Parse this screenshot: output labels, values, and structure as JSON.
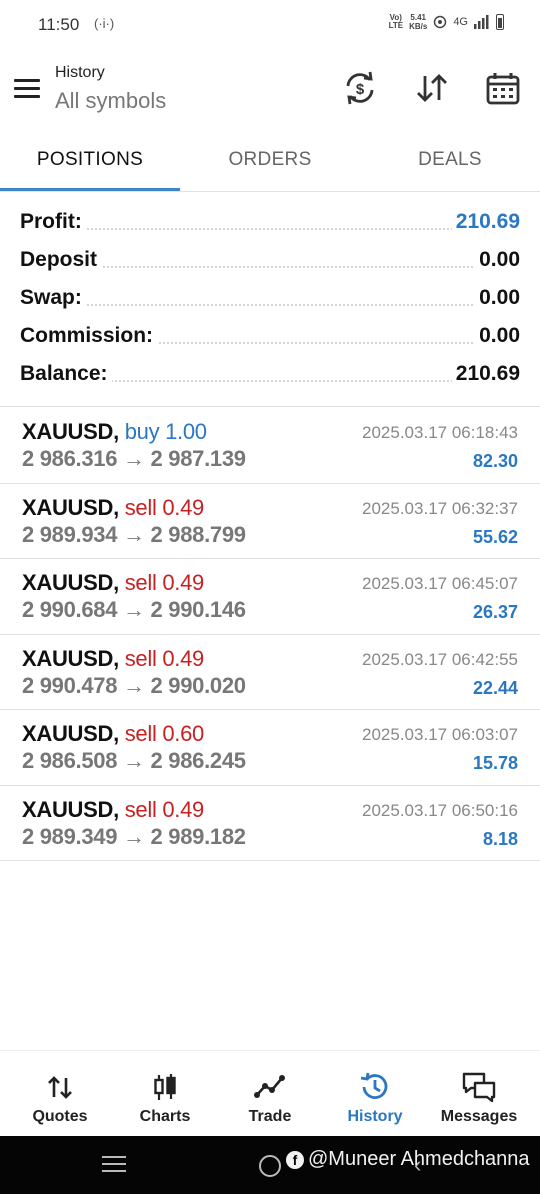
{
  "status_bar": {
    "time": "11:50",
    "hotspot": "(·i·)",
    "volte_top": "Vo)",
    "volte_bottom": "LTE",
    "speed_value": "5.41",
    "speed_unit": "KB/s",
    "network": "4G"
  },
  "header": {
    "title": "History",
    "subtitle": "All symbols"
  },
  "tabs": [
    {
      "label": "POSITIONS",
      "active": true
    },
    {
      "label": "ORDERS",
      "active": false
    },
    {
      "label": "DEALS",
      "active": false
    }
  ],
  "summary": [
    {
      "label": "Profit:",
      "value": "210.69"
    },
    {
      "label": "Deposit",
      "value": "0.00"
    },
    {
      "label": "Swap:",
      "value": "0.00"
    },
    {
      "label": "Commission:",
      "value": "0.00"
    },
    {
      "label": "Balance:",
      "value": "210.69"
    }
  ],
  "trades": [
    {
      "symbol": "XAUUSD,",
      "side": "buy 1.00",
      "side_type": "buy",
      "open": "2 986.316",
      "arrow": "→",
      "close": "2 987.139",
      "time": "2025.03.17 06:18:43",
      "profit": "82.30"
    },
    {
      "symbol": "XAUUSD,",
      "side": "sell 0.49",
      "side_type": "sell",
      "open": "2 989.934",
      "arrow": "→",
      "close": "2 988.799",
      "time": "2025.03.17 06:32:37",
      "profit": "55.62"
    },
    {
      "symbol": "XAUUSD,",
      "side": "sell 0.49",
      "side_type": "sell",
      "open": "2 990.684",
      "arrow": "→",
      "close": "2 990.146",
      "time": "2025.03.17 06:45:07",
      "profit": "26.37"
    },
    {
      "symbol": "XAUUSD,",
      "side": "sell 0.49",
      "side_type": "sell",
      "open": "2 990.478",
      "arrow": "→",
      "close": "2 990.020",
      "time": "2025.03.17 06:42:55",
      "profit": "22.44"
    },
    {
      "symbol": "XAUUSD,",
      "side": "sell 0.60",
      "side_type": "sell",
      "open": "2 986.508",
      "arrow": "→",
      "close": "2 986.245",
      "time": "2025.03.17 06:03:07",
      "profit": "15.78"
    },
    {
      "symbol": "XAUUSD,",
      "side": "sell 0.49",
      "side_type": "sell",
      "open": "2 989.349",
      "arrow": "→",
      "close": "2 989.182",
      "time": "2025.03.17 06:50:16",
      "profit": "8.18"
    }
  ],
  "bottom_nav": [
    {
      "label": "Quotes",
      "icon": "quotes-icon",
      "active": false
    },
    {
      "label": "Charts",
      "icon": "charts-icon",
      "active": false
    },
    {
      "label": "Trade",
      "icon": "trade-icon",
      "active": false
    },
    {
      "label": "History",
      "icon": "history-icon",
      "active": true
    },
    {
      "label": "Messages",
      "icon": "messages-icon",
      "active": false
    }
  ],
  "watermark": {
    "text": "@Muneer Ahmedchanna"
  },
  "colors": {
    "accent": "#2a77c3",
    "sell": "#c62222",
    "underline": "#3d86c6"
  }
}
